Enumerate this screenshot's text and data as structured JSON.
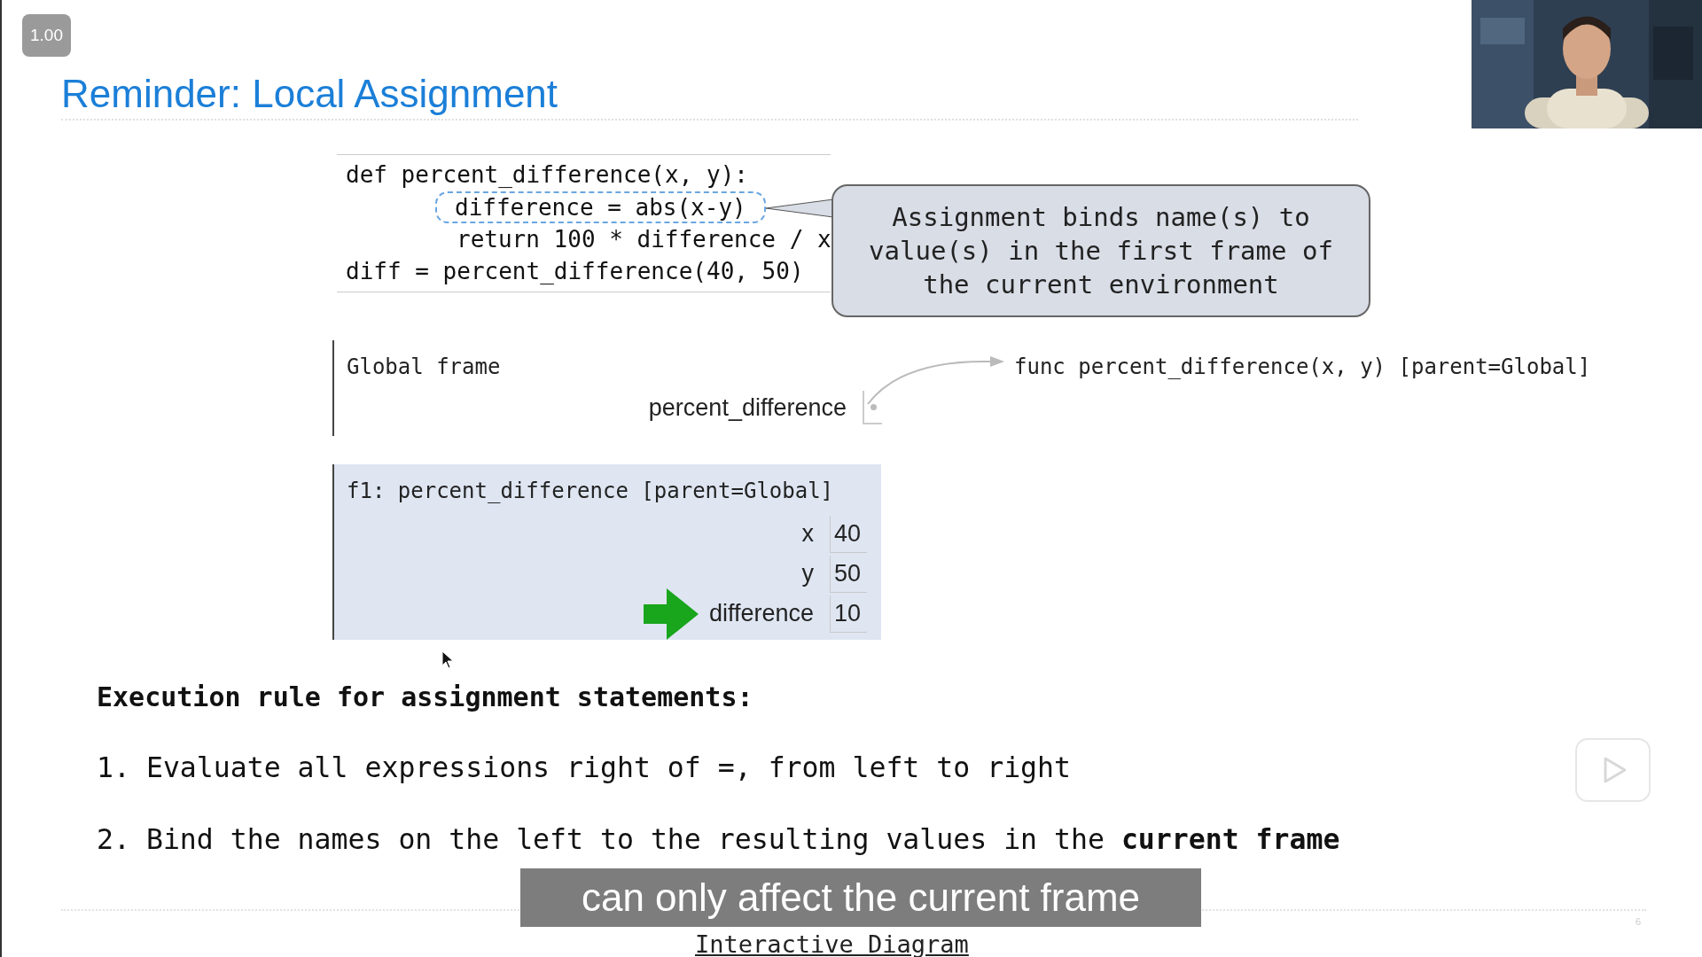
{
  "player": {
    "speed": "1.00",
    "subtitle": "can only affect the current frame"
  },
  "slide": {
    "title": "Reminder: Local Assignment",
    "code": [
      {
        "text": "def percent_difference(x, y):",
        "indented": false,
        "highlighted": false
      },
      {
        "text": "difference = abs(x-y)",
        "indented": true,
        "highlighted": true
      },
      {
        "text": "return 100 * difference / x",
        "indented": true,
        "highlighted": false
      },
      {
        "text": "diff = percent_difference(40, 50)",
        "indented": false,
        "highlighted": false
      }
    ],
    "callout": "Assignment binds name(s) to value(s) in the first frame of the current environment",
    "global_frame": {
      "title": "Global frame",
      "bindings": [
        {
          "name": "percent_difference"
        }
      ],
      "function_object": "func percent_difference(x, y) [parent=Global]"
    },
    "local_frame": {
      "title": "f1: percent_difference [parent=Global]",
      "bindings": [
        {
          "name": "x",
          "value": "40",
          "current": false
        },
        {
          "name": "y",
          "value": "50",
          "current": false
        },
        {
          "name": "difference",
          "value": "10",
          "current": true
        }
      ]
    },
    "rule": {
      "heading": "Execution rule for assignment statements:",
      "items": [
        {
          "number": "1.",
          "text": "Evaluate all expressions right of =, from left to right"
        },
        {
          "number": "2.",
          "text": "Bind the names on the left to the resulting values in the **current frame**"
        }
      ]
    },
    "link": "Interactive Diagram",
    "page_number": "6"
  }
}
